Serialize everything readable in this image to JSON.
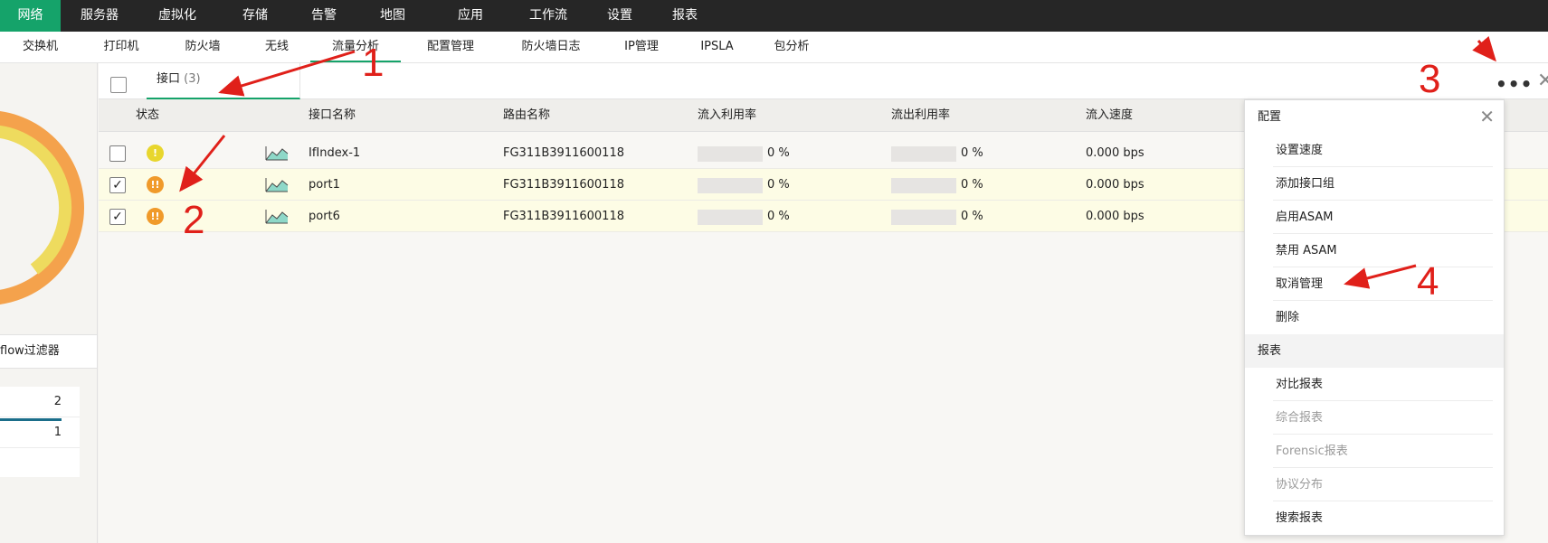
{
  "top_nav": [
    "网络",
    "服务器",
    "虚拟化",
    "存储",
    "告警",
    "地图",
    "应用",
    "工作流",
    "设置",
    "报表"
  ],
  "top_nav_active": 0,
  "sub_nav": [
    "交换机",
    "打印机",
    "防火墙",
    "无线",
    "流量分析",
    "配置管理",
    "防火墙日志",
    "IP管理",
    "IPSLA",
    "包分析"
  ],
  "sub_nav_active": 4,
  "left_panel": {
    "filter_label": "flow过滤器",
    "counts": [
      "2",
      "1"
    ]
  },
  "tab": {
    "label": "接口",
    "count": "(3)"
  },
  "table": {
    "columns": [
      "状态",
      "接口名称",
      "路由名称",
      "流入利用率",
      "流出利用率",
      "流入速度"
    ],
    "rows": [
      {
        "checked": false,
        "status": "yellow",
        "status_glyph": "!",
        "interface": "IfIndex-1",
        "router": "FG311B3911600118",
        "in_util": 0,
        "in_util_text": "0 %",
        "out_util": 0,
        "out_util_text": "0 %",
        "in_speed": "0.000 bps"
      },
      {
        "checked": true,
        "status": "orange",
        "status_glyph": "!!",
        "interface": "port1",
        "router": "FG311B3911600118",
        "in_util": 0,
        "in_util_text": "0 %",
        "out_util": 0,
        "out_util_text": "0 %",
        "in_speed": "0.000 bps"
      },
      {
        "checked": true,
        "status": "orange",
        "status_glyph": "!!",
        "interface": "port6",
        "router": "FG311B3911600118",
        "in_util": 0,
        "in_util_text": "0 %",
        "out_util": 0,
        "out_util_text": "0 %",
        "in_speed": "0.000 bps"
      }
    ]
  },
  "menu": {
    "config_header": "配置",
    "config_items": [
      {
        "label": "设置速度",
        "disabled": false
      },
      {
        "label": "添加接口组",
        "disabled": false
      },
      {
        "label": "启用ASAM",
        "disabled": false
      },
      {
        "label": "禁用 ASAM",
        "disabled": false
      },
      {
        "label": "取消管理",
        "disabled": false
      },
      {
        "label": "删除",
        "disabled": false
      }
    ],
    "report_header": "报表",
    "report_items": [
      {
        "label": "对比报表",
        "disabled": false
      },
      {
        "label": "综合报表",
        "disabled": true
      },
      {
        "label": "Forensic报表",
        "disabled": true
      },
      {
        "label": "协议分布",
        "disabled": true
      },
      {
        "label": "搜索报表",
        "disabled": false
      }
    ]
  },
  "annotations": [
    "1",
    "2",
    "3",
    "4"
  ],
  "colors": {
    "accent": "#15a36a",
    "status_yellow": "#e8d62d",
    "status_orange": "#f09a2a",
    "annotation_red": "#e0201a"
  }
}
